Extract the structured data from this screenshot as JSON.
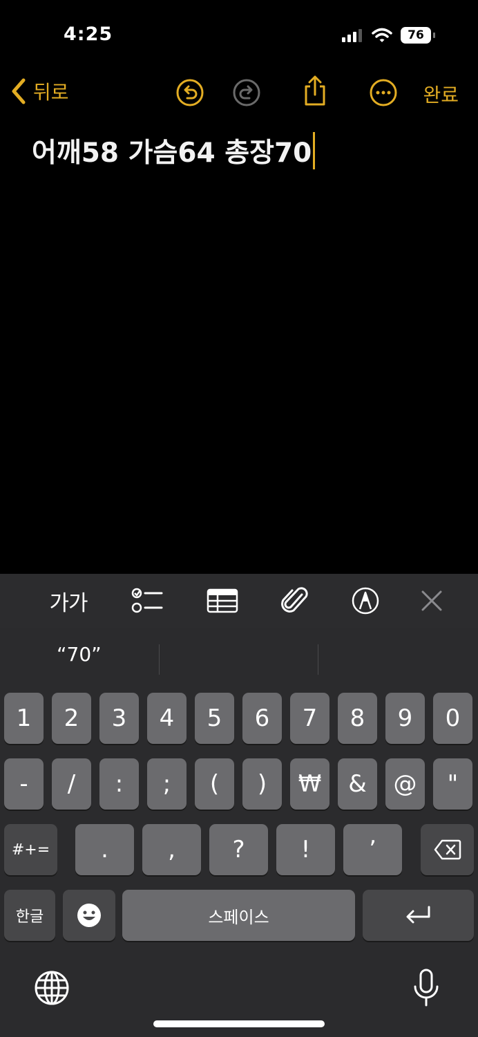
{
  "status_bar": {
    "time": "4:25",
    "battery": "76"
  },
  "nav": {
    "back_label": "뒤로",
    "done_label": "완료"
  },
  "note": {
    "text": "어깨58 가슴64 총장70"
  },
  "toolbar": {
    "text_style_label": "가가"
  },
  "keyboard": {
    "suggestion": "“70”",
    "row1": [
      "1",
      "2",
      "3",
      "4",
      "5",
      "6",
      "7",
      "8",
      "9",
      "0"
    ],
    "row2": [
      "-",
      "/",
      ":",
      ";",
      "(",
      ")",
      "₩",
      "&",
      "@",
      "\""
    ],
    "row3": [
      ".",
      ",",
      "?",
      "!",
      "’"
    ],
    "symbols_key": "#+=",
    "hangul_key": "한글",
    "space_key": "스페이스"
  },
  "colors": {
    "accent": "#e3ad23",
    "keyboard_bg": "#2b2b2d",
    "key_bg": "#6b6b6e",
    "key_dark": "#474749"
  }
}
